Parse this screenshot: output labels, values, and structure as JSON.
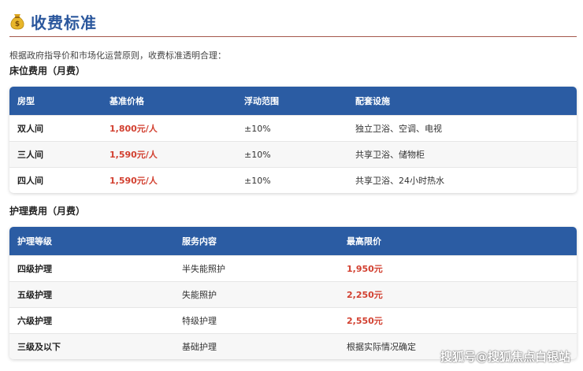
{
  "page": {
    "title": "收费标准",
    "icon": "money-bag-icon",
    "intro": "根据政府指导价和市场化运营原则，收费标准透明合理："
  },
  "bed_section": {
    "title": "床位费用（月费）",
    "headers": [
      "房型",
      "基准价格",
      "浮动范围",
      "配套设施"
    ],
    "rows": [
      [
        "双人间",
        "1,800元/人",
        "±10%",
        "独立卫浴、空调、电视"
      ],
      [
        "三人间",
        "1,590元/人",
        "±10%",
        "共享卫浴、储物柜"
      ],
      [
        "四人间",
        "1,590元/人",
        "±10%",
        "共享卫浴、24小时热水"
      ]
    ]
  },
  "care_section": {
    "title": "护理费用（月费）",
    "headers": [
      "护理等级",
      "服务内容",
      "最高限价"
    ],
    "rows": [
      [
        "四级护理",
        "半失能照护",
        "1,950元"
      ],
      [
        "五级护理",
        "失能照护",
        "2,250元"
      ],
      [
        "六级护理",
        "特级护理",
        "2,550元"
      ],
      [
        "三级及以下",
        "基础护理",
        "根据实际情况确定"
      ]
    ]
  },
  "watermark": "搜狐号@搜狐焦点白银站",
  "colors": {
    "title_blue": "#2b579d",
    "header_blue": "#2b5ca3",
    "price_red": "#d24030",
    "rule": "#a5574c"
  }
}
